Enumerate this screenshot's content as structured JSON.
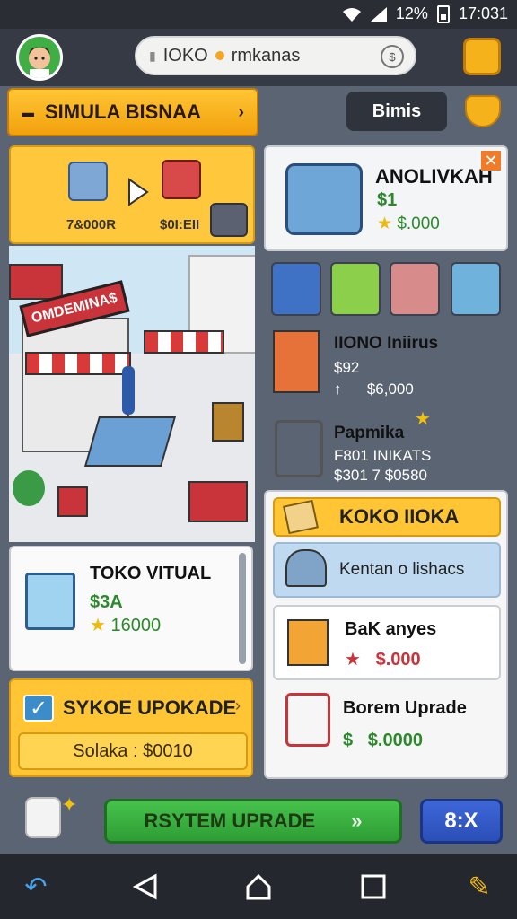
{
  "status_bar": {
    "battery": "12%",
    "time": "17:031"
  },
  "search": {
    "text": "IOKO",
    "text2": "rmkanas"
  },
  "header": {
    "menu_label": "SIMULA BISNAA",
    "bimis_label": "Bimis"
  },
  "conversion": {
    "from_value": "7&000R",
    "to_value": "$0I:EII"
  },
  "city": {
    "shop_sign": "OMDEMINA$"
  },
  "virtual_card": {
    "title": "TOKO VITUAL",
    "price": "$3A",
    "stars_value": "16000"
  },
  "upgrade_card": {
    "title": "SYKOE UPOKADE",
    "solaka": "Solaka : $0010"
  },
  "featured": {
    "title": "ANOLIVKAH",
    "price": "$1",
    "stars_value": "$.000"
  },
  "items": [
    {
      "name": "IIONO Iniirus",
      "line2": "$92",
      "line3": "$6,000"
    },
    {
      "name": "Papmika",
      "line2": "F801 INIKATS",
      "line3": "$301  7  $0580"
    }
  ],
  "panel": {
    "header": "KOKO IIOKA",
    "sub1": "Kentan o lishacs",
    "sub2_name": "BaK anyes",
    "sub2_price": "$.000",
    "sub3_name": "Borem Uprade",
    "sub3_price": "$.0000"
  },
  "actions": {
    "system_upgrade": "RSYTEM UPRADE",
    "go": "»",
    "speed": "8:X"
  },
  "colors": {
    "accent_yellow": "#ffc534",
    "green": "#2e9d34",
    "blue": "#2b4fb7",
    "red": "#c8343a"
  }
}
